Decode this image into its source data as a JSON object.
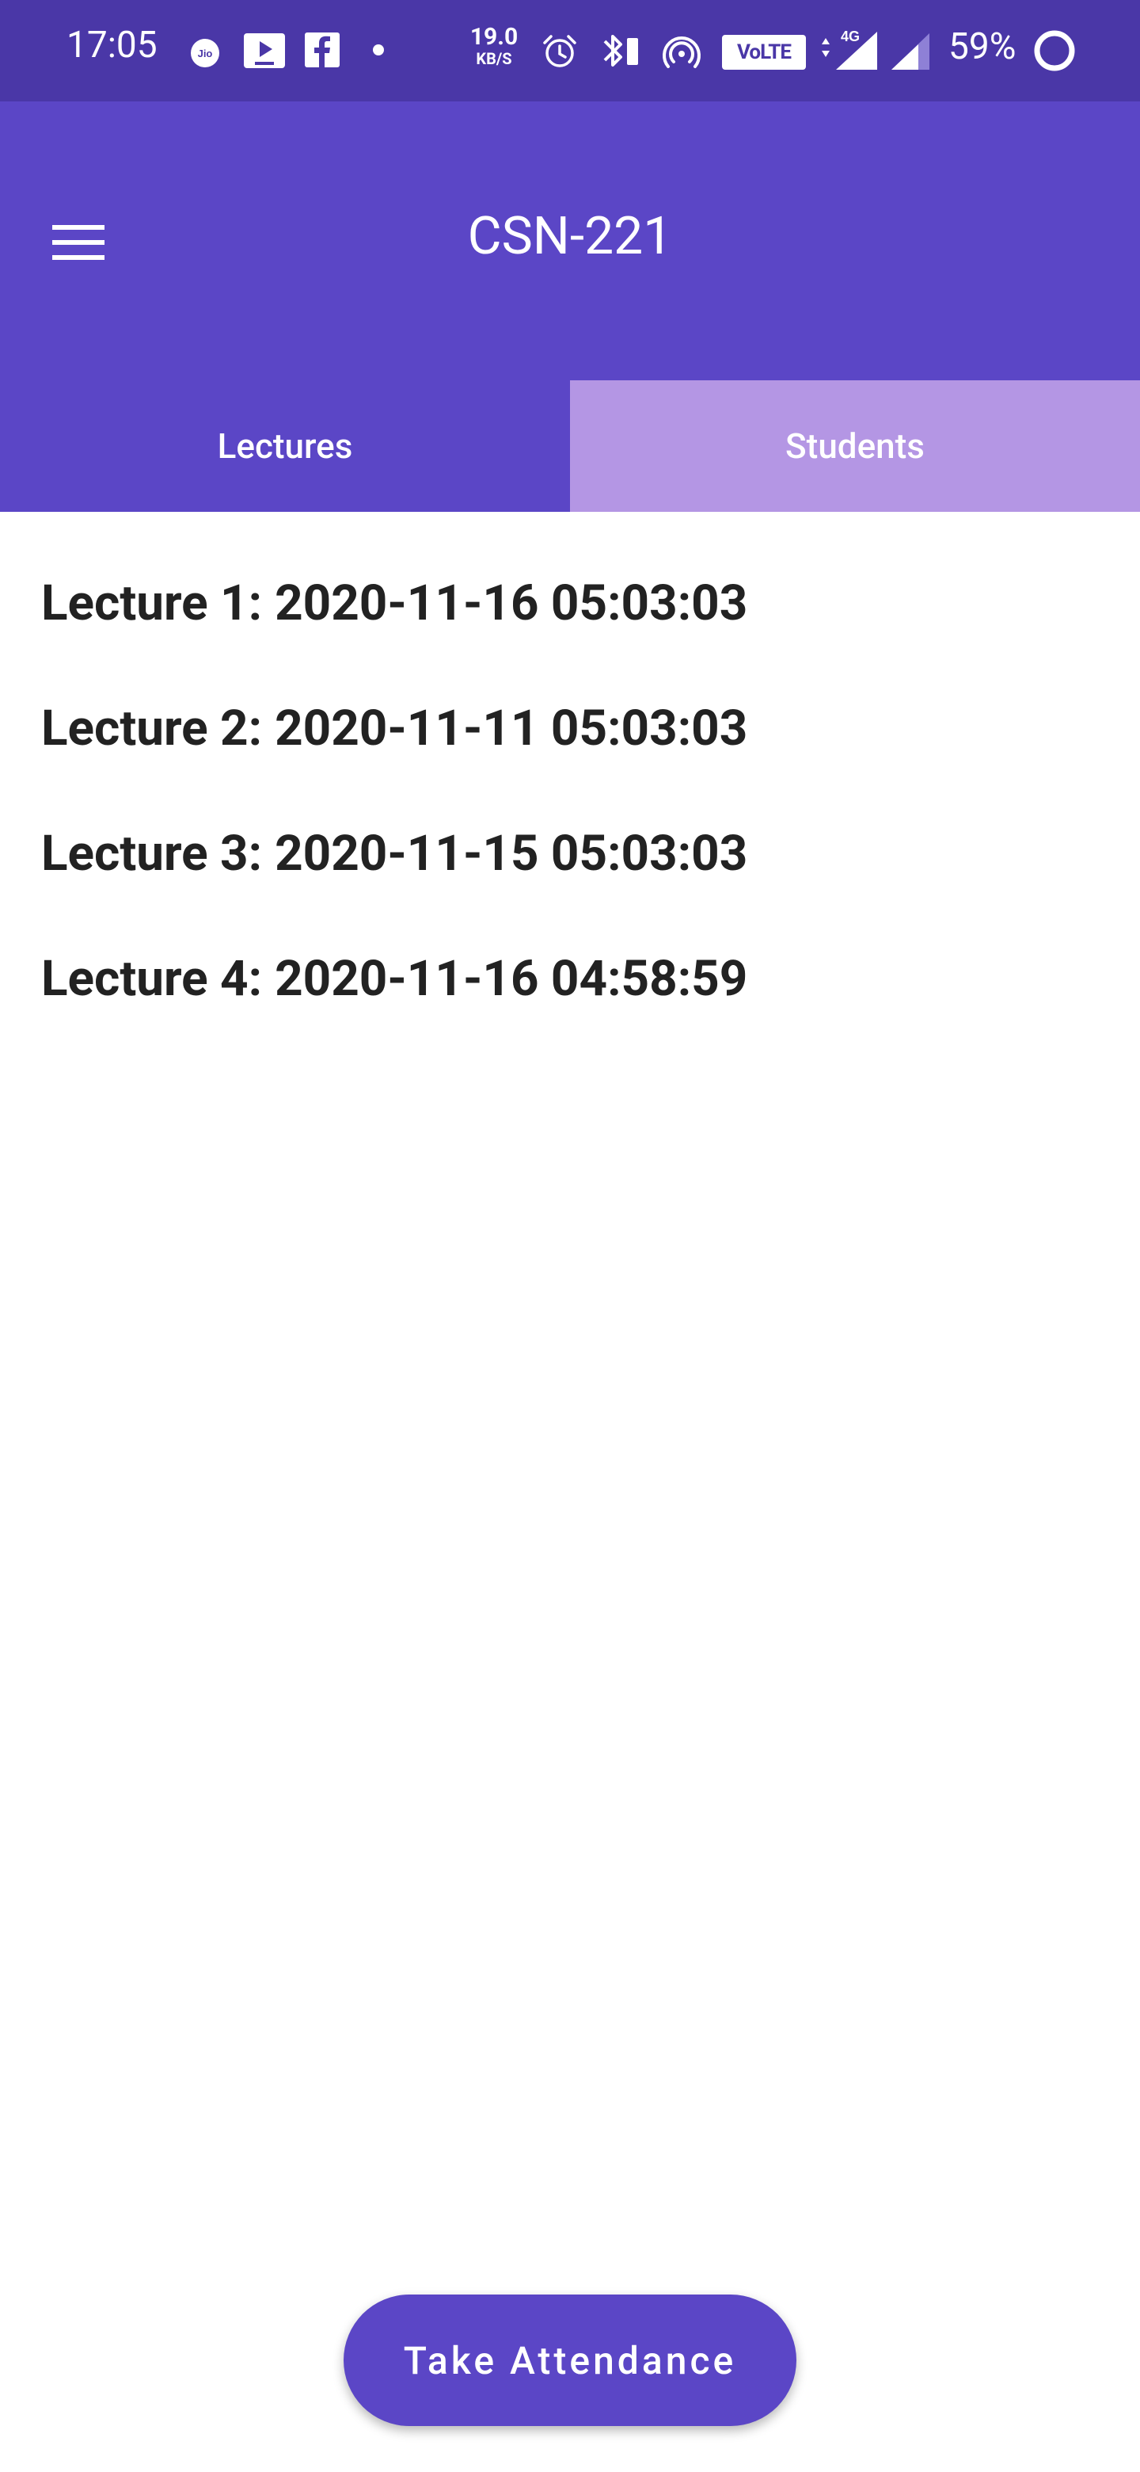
{
  "status_bar": {
    "time": "17:05",
    "net_speed_value": "19.0",
    "net_speed_unit": "KB/S",
    "volte_label": "VoLTE",
    "network_type": "4G",
    "battery_percent": "59%",
    "icons": [
      "jio-icon",
      "youtube-icon",
      "facebook-icon",
      "dot-icon",
      "alarm-icon",
      "bluetooth-icon",
      "hotspot-icon",
      "signal-icon",
      "battery-icon"
    ]
  },
  "app_bar": {
    "title": "CSN-221",
    "menu_icon": "hamburger-menu-icon"
  },
  "tabs": [
    {
      "label": "Lectures",
      "active": true
    },
    {
      "label": "Students",
      "active": false
    }
  ],
  "lectures": [
    {
      "label": "Lecture 1:",
      "datetime": "2020-11-16 05:03:03"
    },
    {
      "label": "Lecture 2:",
      "datetime": "2020-11-11 05:03:03"
    },
    {
      "label": "Lecture 3:",
      "datetime": "2020-11-15 05:03:03"
    },
    {
      "label": "Lecture 4:",
      "datetime": "2020-11-16 04:58:59"
    }
  ],
  "fab": {
    "label": "Take Attendance"
  },
  "colors": {
    "status_bar": "#4a37a7",
    "primary": "#5b46c6",
    "tab_inactive": "#b496e4",
    "text_dark": "#222222"
  }
}
